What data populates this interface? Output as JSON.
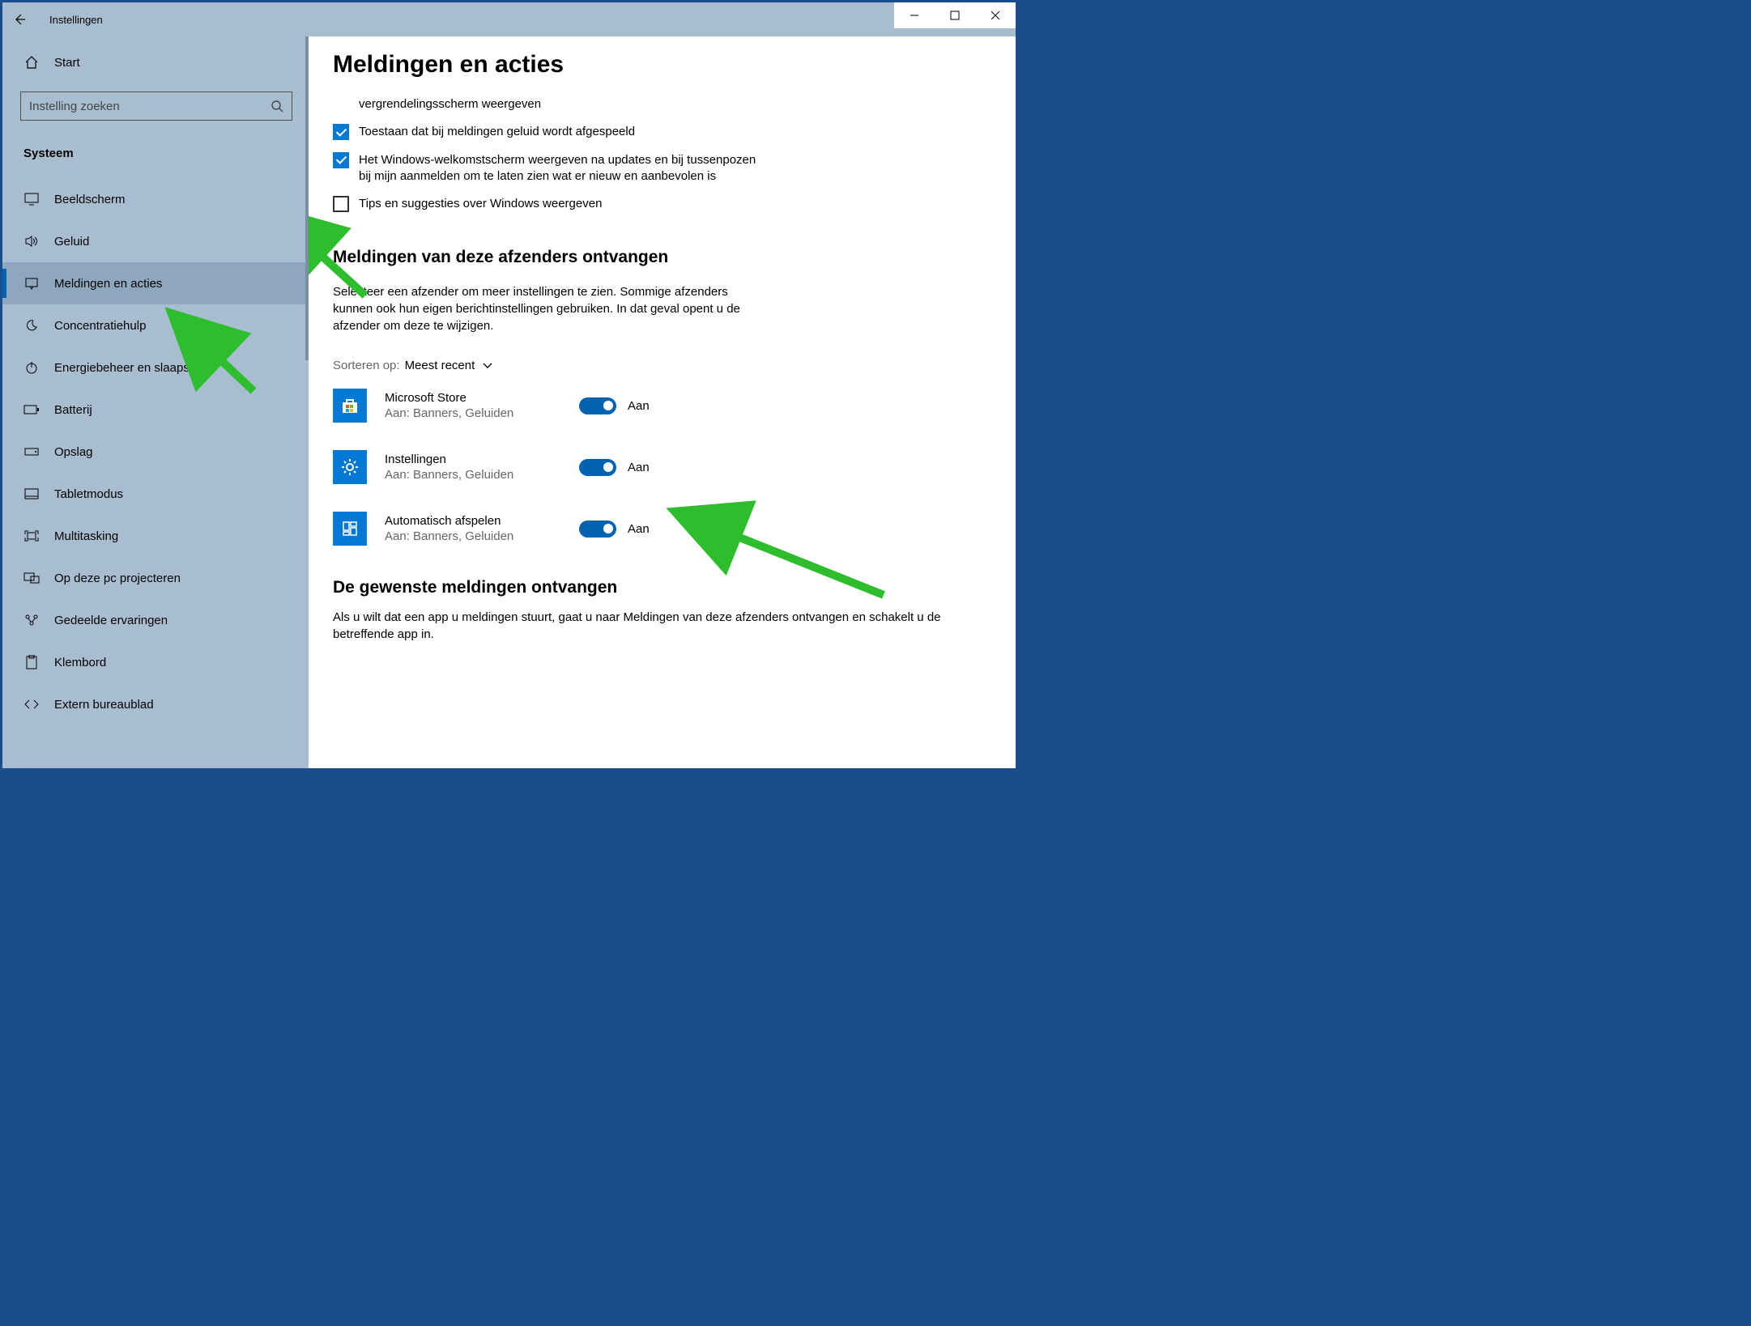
{
  "window": {
    "title": "Instellingen"
  },
  "sidebar": {
    "home": "Start",
    "search_placeholder": "Instelling zoeken",
    "section": "Systeem",
    "items": [
      {
        "icon": "display",
        "label": "Beeldscherm"
      },
      {
        "icon": "sound",
        "label": "Geluid"
      },
      {
        "icon": "notify",
        "label": "Meldingen en acties"
      },
      {
        "icon": "moon",
        "label": "Concentratiehulp"
      },
      {
        "icon": "power",
        "label": "Energiebeheer en slaapstand"
      },
      {
        "icon": "battery",
        "label": "Batterij"
      },
      {
        "icon": "storage",
        "label": "Opslag"
      },
      {
        "icon": "tablet",
        "label": "Tabletmodus"
      },
      {
        "icon": "multitask",
        "label": "Multitasking"
      },
      {
        "icon": "project",
        "label": "Op deze pc projecteren"
      },
      {
        "icon": "shared",
        "label": "Gedeelde ervaringen"
      },
      {
        "icon": "clipboard",
        "label": "Klembord"
      },
      {
        "icon": "remote",
        "label": "Extern bureaublad"
      }
    ]
  },
  "main": {
    "title": "Meldingen en acties",
    "checkboxes": [
      {
        "checked": true,
        "partial": true,
        "label": "vergrendelingsscherm weergeven"
      },
      {
        "checked": true,
        "label": "Toestaan dat bij meldingen geluid wordt afgespeeld"
      },
      {
        "checked": true,
        "label": "Het Windows-welkomstscherm weergeven na updates en bij tussenpozen bij mijn aanmelden om te laten zien wat er nieuw en aanbevolen is"
      },
      {
        "checked": false,
        "label": "Tips en suggesties over Windows weergeven"
      }
    ],
    "senders_title": "Meldingen van deze afzenders ontvangen",
    "senders_desc": "Selecteer een afzender om meer instellingen te zien. Sommige afzenders kunnen ook hun eigen berichtinstellingen gebruiken. In dat geval opent u de afzender om deze te wijzigen.",
    "sort_label": "Sorteren op:",
    "sort_value": "Meest recent",
    "senders": [
      {
        "name": "Microsoft Store",
        "sub": "Aan: Banners, Geluiden",
        "state": "Aan",
        "icon": "store"
      },
      {
        "name": "Instellingen",
        "sub": "Aan: Banners, Geluiden",
        "state": "Aan",
        "icon": "gear"
      },
      {
        "name": "Automatisch afspelen",
        "sub": "Aan: Banners, Geluiden",
        "state": "Aan",
        "icon": "grid"
      }
    ],
    "desired_title": "De gewenste meldingen ontvangen",
    "desired_desc": "Als u wilt dat een app u meldingen stuurt, gaat u naar Meldingen van deze afzenders ontvangen en schakelt u de betreffende app in."
  }
}
